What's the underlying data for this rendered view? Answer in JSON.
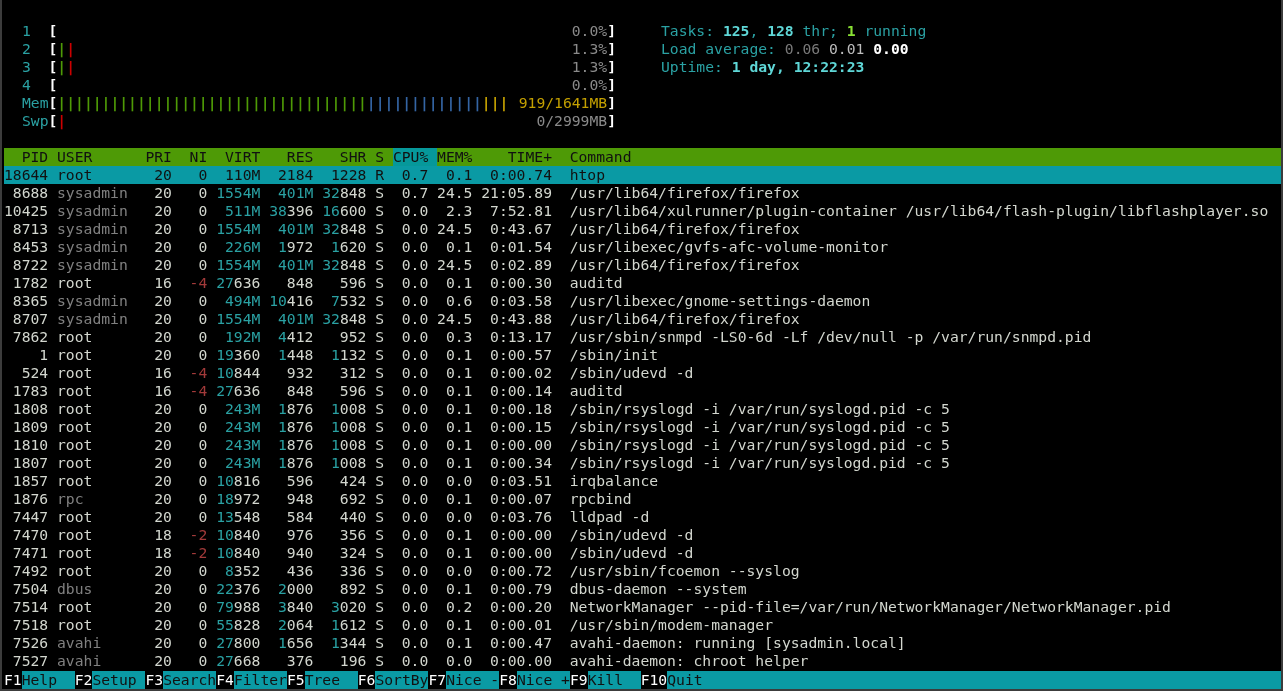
{
  "meters": [
    {
      "kind": "cpu",
      "label": "1",
      "open": "[",
      "close": "]",
      "value": "0.0%"
    },
    {
      "kind": "cpu",
      "label": "2",
      "open": "[",
      "close": "]",
      "value": "1.3%",
      "segments": [
        {
          "color": "#4e9a06",
          "text": "|"
        },
        {
          "color": "#cc0000",
          "text": "|"
        }
      ]
    },
    {
      "kind": "cpu",
      "label": "3",
      "open": "[",
      "close": "]",
      "value": "1.3%",
      "segments": [
        {
          "color": "#4e9a06",
          "text": "|"
        },
        {
          "color": "#cc0000",
          "text": "|"
        }
      ]
    },
    {
      "kind": "cpu",
      "label": "4",
      "open": "[",
      "close": "]",
      "value": "0.0%"
    },
    {
      "kind": "memory",
      "label": "Mem",
      "open": "[",
      "close": "]",
      "value": "919/1641MB",
      "segments": [
        {
          "color": "#4e9a06",
          "text": "|||||||||||||||||||||||||||||||||||"
        },
        {
          "color": "#3465a4",
          "text": "|||||||||||||"
        },
        {
          "color": "#c4a000",
          "text": "|||"
        }
      ]
    },
    {
      "kind": "swap",
      "label": "Swp",
      "open": "[",
      "close": "]",
      "value": "0/2999MB",
      "segments": [
        {
          "color": "#cc0000",
          "text": "|"
        }
      ]
    }
  ],
  "summary": [
    {
      "segments": [
        {
          "kind": "label",
          "text": "Tasks: "
        },
        {
          "kind": "value",
          "text": "125"
        },
        {
          "kind": "label",
          "text": ", "
        },
        {
          "kind": "value",
          "text": "128"
        },
        {
          "kind": "label",
          "text": " thr; "
        },
        {
          "kind": "running",
          "text": "1"
        },
        {
          "kind": "label",
          "text": " running"
        }
      ]
    },
    {
      "segments": [
        {
          "kind": "label",
          "text": "Load average: "
        },
        {
          "kind": "load1",
          "text": "0.06"
        },
        {
          "kind": "load5",
          "text": " 0.01"
        },
        {
          "kind": "load15",
          "text": " 0.00"
        }
      ]
    },
    {
      "segments": [
        {
          "kind": "label",
          "text": "Uptime: "
        },
        {
          "kind": "value",
          "text": "1 day, 12:22:23"
        }
      ]
    }
  ],
  "columns": [
    {
      "label": "PID",
      "selected": false
    },
    {
      "label": "USER",
      "selected": false
    },
    {
      "label": "PRI",
      "selected": false
    },
    {
      "label": "NI",
      "selected": false
    },
    {
      "label": "VIRT",
      "selected": false
    },
    {
      "label": "RES",
      "selected": false
    },
    {
      "label": "SHR",
      "selected": false
    },
    {
      "label": "S",
      "selected": false
    },
    {
      "label": "CPU%",
      "selected": true
    },
    {
      "label": "MEM%",
      "selected": false
    },
    {
      "label": "TIME+",
      "selected": false
    },
    {
      "label": "Command",
      "selected": false
    }
  ],
  "processes": [
    {
      "pid": "18644",
      "user": "root",
      "pri": "20",
      "ni": "0",
      "virt": "110M",
      "res": "2184",
      "shr": "1228",
      "state": "R",
      "cpu": "0.7",
      "mem": "0.1",
      "time": "0:00.74",
      "command": "htop",
      "selected": true,
      "user_dimmed": false,
      "nice_negative": false
    },
    {
      "pid": "8688",
      "user": "sysadmin",
      "pri": "20",
      "ni": "0",
      "virt": "1554M",
      "res": "401M",
      "shr": "32848",
      "state": "S",
      "cpu": "0.7",
      "mem": "24.5",
      "time": "21:05.89",
      "command": "/usr/lib64/firefox/firefox",
      "selected": false,
      "user_dimmed": true,
      "nice_negative": false
    },
    {
      "pid": "10425",
      "user": "sysadmin",
      "pri": "20",
      "ni": "0",
      "virt": "511M",
      "res": "38396",
      "shr": "16600",
      "state": "S",
      "cpu": "0.0",
      "mem": "2.3",
      "time": "7:52.81",
      "command": "/usr/lib64/xulrunner/plugin-container /usr/lib64/flash-plugin/libflashplayer.so",
      "selected": false,
      "user_dimmed": true,
      "nice_negative": false
    },
    {
      "pid": "8713",
      "user": "sysadmin",
      "pri": "20",
      "ni": "0",
      "virt": "1554M",
      "res": "401M",
      "shr": "32848",
      "state": "S",
      "cpu": "0.0",
      "mem": "24.5",
      "time": "0:43.67",
      "command": "/usr/lib64/firefox/firefox",
      "selected": false,
      "user_dimmed": true,
      "nice_negative": false
    },
    {
      "pid": "8453",
      "user": "sysadmin",
      "pri": "20",
      "ni": "0",
      "virt": "226M",
      "res": "1972",
      "shr": "1620",
      "state": "S",
      "cpu": "0.0",
      "mem": "0.1",
      "time": "0:01.54",
      "command": "/usr/libexec/gvfs-afc-volume-monitor",
      "selected": false,
      "user_dimmed": true,
      "nice_negative": false
    },
    {
      "pid": "8722",
      "user": "sysadmin",
      "pri": "20",
      "ni": "0",
      "virt": "1554M",
      "res": "401M",
      "shr": "32848",
      "state": "S",
      "cpu": "0.0",
      "mem": "24.5",
      "time": "0:02.89",
      "command": "/usr/lib64/firefox/firefox",
      "selected": false,
      "user_dimmed": true,
      "nice_negative": false
    },
    {
      "pid": "1782",
      "user": "root",
      "pri": "16",
      "ni": "-4",
      "virt": "27636",
      "res": "848",
      "shr": "596",
      "state": "S",
      "cpu": "0.0",
      "mem": "0.1",
      "time": "0:00.30",
      "command": "auditd",
      "selected": false,
      "user_dimmed": false,
      "nice_negative": true
    },
    {
      "pid": "8365",
      "user": "sysadmin",
      "pri": "20",
      "ni": "0",
      "virt": "494M",
      "res": "10416",
      "shr": "7532",
      "state": "S",
      "cpu": "0.0",
      "mem": "0.6",
      "time": "0:03.58",
      "command": "/usr/libexec/gnome-settings-daemon",
      "selected": false,
      "user_dimmed": true,
      "nice_negative": false
    },
    {
      "pid": "8707",
      "user": "sysadmin",
      "pri": "20",
      "ni": "0",
      "virt": "1554M",
      "res": "401M",
      "shr": "32848",
      "state": "S",
      "cpu": "0.0",
      "mem": "24.5",
      "time": "0:43.88",
      "command": "/usr/lib64/firefox/firefox",
      "selected": false,
      "user_dimmed": true,
      "nice_negative": false
    },
    {
      "pid": "7862",
      "user": "root",
      "pri": "20",
      "ni": "0",
      "virt": "192M",
      "res": "4412",
      "shr": "952",
      "state": "S",
      "cpu": "0.0",
      "mem": "0.3",
      "time": "0:13.17",
      "command": "/usr/sbin/snmpd -LS0-6d -Lf /dev/null -p /var/run/snmpd.pid",
      "selected": false,
      "user_dimmed": false,
      "nice_negative": false
    },
    {
      "pid": "1",
      "user": "root",
      "pri": "20",
      "ni": "0",
      "virt": "19360",
      "res": "1448",
      "shr": "1132",
      "state": "S",
      "cpu": "0.0",
      "mem": "0.1",
      "time": "0:00.57",
      "command": "/sbin/init",
      "selected": false,
      "user_dimmed": false,
      "nice_negative": false
    },
    {
      "pid": "524",
      "user": "root",
      "pri": "16",
      "ni": "-4",
      "virt": "10844",
      "res": "932",
      "shr": "312",
      "state": "S",
      "cpu": "0.0",
      "mem": "0.1",
      "time": "0:00.02",
      "command": "/sbin/udevd -d",
      "selected": false,
      "user_dimmed": false,
      "nice_negative": true
    },
    {
      "pid": "1783",
      "user": "root",
      "pri": "16",
      "ni": "-4",
      "virt": "27636",
      "res": "848",
      "shr": "596",
      "state": "S",
      "cpu": "0.0",
      "mem": "0.1",
      "time": "0:00.14",
      "command": "auditd",
      "selected": false,
      "user_dimmed": false,
      "nice_negative": true
    },
    {
      "pid": "1808",
      "user": "root",
      "pri": "20",
      "ni": "0",
      "virt": "243M",
      "res": "1876",
      "shr": "1008",
      "state": "S",
      "cpu": "0.0",
      "mem": "0.1",
      "time": "0:00.18",
      "command": "/sbin/rsyslogd -i /var/run/syslogd.pid -c 5",
      "selected": false,
      "user_dimmed": false,
      "nice_negative": false
    },
    {
      "pid": "1809",
      "user": "root",
      "pri": "20",
      "ni": "0",
      "virt": "243M",
      "res": "1876",
      "shr": "1008",
      "state": "S",
      "cpu": "0.0",
      "mem": "0.1",
      "time": "0:00.15",
      "command": "/sbin/rsyslogd -i /var/run/syslogd.pid -c 5",
      "selected": false,
      "user_dimmed": false,
      "nice_negative": false
    },
    {
      "pid": "1810",
      "user": "root",
      "pri": "20",
      "ni": "0",
      "virt": "243M",
      "res": "1876",
      "shr": "1008",
      "state": "S",
      "cpu": "0.0",
      "mem": "0.1",
      "time": "0:00.00",
      "command": "/sbin/rsyslogd -i /var/run/syslogd.pid -c 5",
      "selected": false,
      "user_dimmed": false,
      "nice_negative": false
    },
    {
      "pid": "1807",
      "user": "root",
      "pri": "20",
      "ni": "0",
      "virt": "243M",
      "res": "1876",
      "shr": "1008",
      "state": "S",
      "cpu": "0.0",
      "mem": "0.1",
      "time": "0:00.34",
      "command": "/sbin/rsyslogd -i /var/run/syslogd.pid -c 5",
      "selected": false,
      "user_dimmed": false,
      "nice_negative": false
    },
    {
      "pid": "1857",
      "user": "root",
      "pri": "20",
      "ni": "0",
      "virt": "10816",
      "res": "596",
      "shr": "424",
      "state": "S",
      "cpu": "0.0",
      "mem": "0.0",
      "time": "0:03.51",
      "command": "irqbalance",
      "selected": false,
      "user_dimmed": false,
      "nice_negative": false
    },
    {
      "pid": "1876",
      "user": "rpc",
      "pri": "20",
      "ni": "0",
      "virt": "18972",
      "res": "948",
      "shr": "692",
      "state": "S",
      "cpu": "0.0",
      "mem": "0.1",
      "time": "0:00.07",
      "command": "rpcbind",
      "selected": false,
      "user_dimmed": true,
      "nice_negative": false
    },
    {
      "pid": "7447",
      "user": "root",
      "pri": "20",
      "ni": "0",
      "virt": "13548",
      "res": "584",
      "shr": "440",
      "state": "S",
      "cpu": "0.0",
      "mem": "0.0",
      "time": "0:03.76",
      "command": "lldpad -d",
      "selected": false,
      "user_dimmed": false,
      "nice_negative": false
    },
    {
      "pid": "7470",
      "user": "root",
      "pri": "18",
      "ni": "-2",
      "virt": "10840",
      "res": "976",
      "shr": "356",
      "state": "S",
      "cpu": "0.0",
      "mem": "0.1",
      "time": "0:00.00",
      "command": "/sbin/udevd -d",
      "selected": false,
      "user_dimmed": false,
      "nice_negative": true
    },
    {
      "pid": "7471",
      "user": "root",
      "pri": "18",
      "ni": "-2",
      "virt": "10840",
      "res": "940",
      "shr": "324",
      "state": "S",
      "cpu": "0.0",
      "mem": "0.1",
      "time": "0:00.00",
      "command": "/sbin/udevd -d",
      "selected": false,
      "user_dimmed": false,
      "nice_negative": true
    },
    {
      "pid": "7492",
      "user": "root",
      "pri": "20",
      "ni": "0",
      "virt": "8352",
      "res": "436",
      "shr": "336",
      "state": "S",
      "cpu": "0.0",
      "mem": "0.0",
      "time": "0:00.72",
      "command": "/usr/sbin/fcoemon --syslog",
      "selected": false,
      "user_dimmed": false,
      "nice_negative": false
    },
    {
      "pid": "7504",
      "user": "dbus",
      "pri": "20",
      "ni": "0",
      "virt": "22376",
      "res": "2000",
      "shr": "892",
      "state": "S",
      "cpu": "0.0",
      "mem": "0.1",
      "time": "0:00.79",
      "command": "dbus-daemon --system",
      "selected": false,
      "user_dimmed": true,
      "nice_negative": false
    },
    {
      "pid": "7514",
      "user": "root",
      "pri": "20",
      "ni": "0",
      "virt": "79988",
      "res": "3840",
      "shr": "3020",
      "state": "S",
      "cpu": "0.0",
      "mem": "0.2",
      "time": "0:00.20",
      "command": "NetworkManager --pid-file=/var/run/NetworkManager/NetworkManager.pid",
      "selected": false,
      "user_dimmed": false,
      "nice_negative": false
    },
    {
      "pid": "7518",
      "user": "root",
      "pri": "20",
      "ni": "0",
      "virt": "55828",
      "res": "2064",
      "shr": "1612",
      "state": "S",
      "cpu": "0.0",
      "mem": "0.1",
      "time": "0:00.01",
      "command": "/usr/sbin/modem-manager",
      "selected": false,
      "user_dimmed": false,
      "nice_negative": false
    },
    {
      "pid": "7526",
      "user": "avahi",
      "pri": "20",
      "ni": "0",
      "virt": "27800",
      "res": "1656",
      "shr": "1344",
      "state": "S",
      "cpu": "0.0",
      "mem": "0.1",
      "time": "0:00.47",
      "command": "avahi-daemon: running [sysadmin.local]",
      "selected": false,
      "user_dimmed": true,
      "nice_negative": false
    },
    {
      "pid": "7527",
      "user": "avahi",
      "pri": "20",
      "ni": "0",
      "virt": "27668",
      "res": "376",
      "shr": "196",
      "state": "S",
      "cpu": "0.0",
      "mem": "0.0",
      "time": "0:00.00",
      "command": "avahi-daemon: chroot helper",
      "selected": false,
      "user_dimmed": true,
      "nice_negative": false
    }
  ],
  "function_keys": [
    {
      "key": "F1",
      "label": "Help"
    },
    {
      "key": "F2",
      "label": "Setup"
    },
    {
      "key": "F3",
      "label": "Search"
    },
    {
      "key": "F4",
      "label": "Filter"
    },
    {
      "key": "F5",
      "label": "Tree"
    },
    {
      "key": "F6",
      "label": "SortBy"
    },
    {
      "key": "F7",
      "label": "Nice -"
    },
    {
      "key": "F8",
      "label": "Nice +"
    },
    {
      "key": "F9",
      "label": "Kill"
    },
    {
      "key": "F10",
      "label": "Quit"
    }
  ]
}
